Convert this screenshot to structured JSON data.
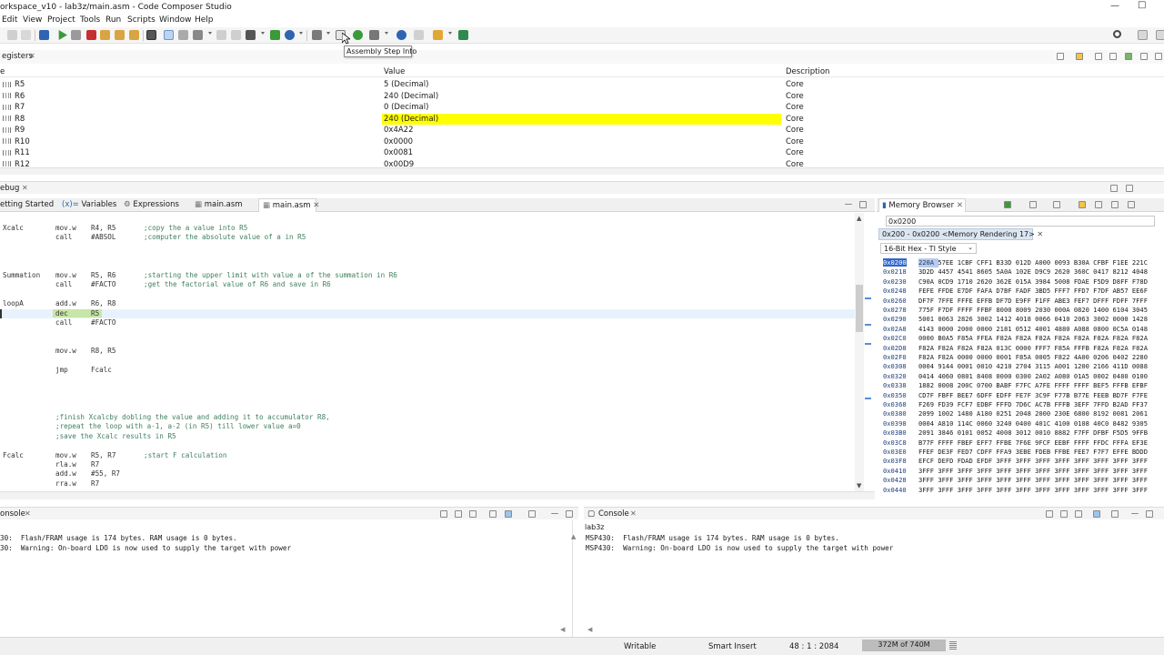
{
  "window": {
    "title": "orkspace_v10 - lab3z/main.asm - Code Composer Studio"
  },
  "menu": [
    "Edit",
    "View",
    "Project",
    "Tools",
    "Run",
    "Scripts",
    "Window",
    "Help"
  ],
  "tooltip": "Assembly Step Into",
  "registers": {
    "tab": "egisters",
    "headers": {
      "name": "e",
      "value": "Value",
      "description": "Description"
    },
    "rows": [
      {
        "name": "R5",
        "value": "5 (Decimal)",
        "description": "Core"
      },
      {
        "name": "R6",
        "value": "240 (Decimal)",
        "description": "Core"
      },
      {
        "name": "R7",
        "value": "0 (Decimal)",
        "description": "Core"
      },
      {
        "name": "R8",
        "value": "240 (Decimal)",
        "description": "Core",
        "changed": true
      },
      {
        "name": "R9",
        "value": "0x4A22",
        "description": "Core"
      },
      {
        "name": "R10",
        "value": "0x0000",
        "description": "Core"
      },
      {
        "name": "R11",
        "value": "0x0081",
        "description": "Core"
      },
      {
        "name": "R12",
        "value": "0x00D9",
        "description": "Core"
      }
    ]
  },
  "debug": {
    "tab": "ebug"
  },
  "editor": {
    "tabs": [
      "etting Started",
      "Variables",
      "Expressions",
      "main.asm",
      "main.asm"
    ],
    "lines": [
      {
        "label": "Xcalc",
        "ins": "mov.w",
        "opd": "R4, R5",
        "cmt": ";copy the a value into R5"
      },
      {
        "label": "",
        "ins": "call",
        "opd": "#ABSOL",
        "cmt": ";computer the absolute value of a in R5"
      },
      {
        "label": "",
        "ins": "",
        "opd": "",
        "cmt": ""
      },
      {
        "label": "",
        "ins": "",
        "opd": "",
        "cmt": ""
      },
      {
        "label": "",
        "ins": "",
        "opd": "",
        "cmt": ""
      },
      {
        "label": "Summation",
        "ins": "mov.w",
        "opd": "R5, R6",
        "cmt": ";starting the upper limit with value a of the summation in R6"
      },
      {
        "label": "",
        "ins": "call",
        "opd": "#FACTO",
        "cmt": ";get the factorial value of R6 and save in R6"
      },
      {
        "label": "",
        "ins": "",
        "opd": "",
        "cmt": ""
      },
      {
        "label": "loopA",
        "ins": "add.w",
        "opd": "R6, R8",
        "cmt": ""
      },
      {
        "label": "",
        "ins": "dec",
        "opd": "R5",
        "cmt": "",
        "current": true
      },
      {
        "label": "",
        "ins": "call",
        "opd": "#FACTO",
        "cmt": ""
      },
      {
        "label": "",
        "ins": "",
        "opd": "",
        "cmt": ""
      },
      {
        "label": "",
        "ins": "",
        "opd": "",
        "cmt": ""
      },
      {
        "label": "",
        "ins": "mov.w",
        "opd": "R8, R5",
        "cmt": ""
      },
      {
        "label": "",
        "ins": "",
        "opd": "",
        "cmt": ""
      },
      {
        "label": "",
        "ins": "jmp",
        "opd": "Fcalc",
        "cmt": ""
      },
      {
        "label": "",
        "ins": "",
        "opd": "",
        "cmt": ""
      },
      {
        "label": "",
        "ins": "",
        "opd": "",
        "cmt": ""
      },
      {
        "label": "",
        "ins": "",
        "opd": "",
        "cmt": ""
      },
      {
        "label": "",
        "ins": "",
        "opd": "",
        "cmt": ""
      },
      {
        "label": "",
        "ins": "",
        "opd": "",
        "cmt": "",
        "cmtline": ";finish Xcalcby dobling the value and adding it to accumulator R8,"
      },
      {
        "label": "",
        "ins": "",
        "opd": "",
        "cmt": "",
        "cmtline": ";repeat the loop with a-1, a-2 (in R5) till lower value a=0"
      },
      {
        "label": "",
        "ins": "",
        "opd": "",
        "cmt": "",
        "cmtline": ";save the Xcalc results in R5"
      },
      {
        "label": "",
        "ins": "",
        "opd": "",
        "cmt": ""
      },
      {
        "label": "Fcalc",
        "ins": "mov.w",
        "opd": "R5, R7",
        "cmt": ";start F calculation"
      },
      {
        "label": "",
        "ins": "rla.w",
        "opd": "R7",
        "cmt": ""
      },
      {
        "label": "",
        "ins": "add.w",
        "opd": "#55, R7",
        "cmt": ""
      },
      {
        "label": "",
        "ins": "rra.w",
        "opd": "R7",
        "cmt": ""
      }
    ]
  },
  "memory": {
    "tab": "Memory Browser",
    "address_input": "0x0200",
    "rendering_tab": "0x200 - 0x0200 <Memory Rendering 17>",
    "style": "16-Bit Hex - TI Style",
    "rows": [
      {
        "addr": "0x0200",
        "words": "220A 57EE 1CBF CFF1 B33D 012D A000 0093 B30A CFBF F1EE 221C"
      },
      {
        "addr": "0x0218",
        "words": "3D2D 4457 4541 8605 5A0A 102E D9C9 2620 360C 0417 8212 4048"
      },
      {
        "addr": "0x0230",
        "words": "C90A 0CD9 1710 2620 362E 015A 3984 5008 FDAE F5D9 D8FF F78D"
      },
      {
        "addr": "0x0248",
        "words": "FEFE FFDE E7DF FAFA D7BF FADF 3BD5 FFF7 FFD7 F7DF AB57 EE6F"
      },
      {
        "addr": "0x0260",
        "words": "DF7F 7FFE FFFE EFFB DF7D E9FF F1FF ABE3 FEF7 DFFF FDFF 7FFF"
      },
      {
        "addr": "0x0278",
        "words": "775F F7DF FFFF FFBF 8000 8009 2030 000A 0820 1400 6104 3045"
      },
      {
        "addr": "0x0290",
        "words": "5001 0063 2826 3002 1412 4018 0066 0410 2063 3002 0000 1428"
      },
      {
        "addr": "0x02A8",
        "words": "4143 0000 2000 0000 2181 0512 4001 4880 A088 0800 0C5A 0148"
      },
      {
        "addr": "0x02C0",
        "words": "0000 B0A5 F85A FFEA F82A F82A F82A F82A F82A F82A F82A F82A"
      },
      {
        "addr": "0x02D8",
        "words": "F82A F82A F82A F82A 013C 0000 FFF7 F85A FFFB F82A F82A F82A"
      },
      {
        "addr": "0x02F0",
        "words": "F82A F82A 0000 0000 0001 F85A 0005 F822 4A00 0206 0402 2280"
      },
      {
        "addr": "0x0308",
        "words": "0004 9144 0001 0010 4210 2704 3115 A001 1200 2166 411D 0088"
      },
      {
        "addr": "0x0320",
        "words": "0414 4060 0801 8408 0000 0300 2A02 A080 01A5 0002 0480 0100"
      },
      {
        "addr": "0x0338",
        "words": "1882 0008 200C 0700 BABF F7FC A7FE FFFF FFFF BEF5 FFFB EFBF"
      },
      {
        "addr": "0x0350",
        "words": "CD7F FBFF BEE7 6DFF EDFF FE7F 3C9F F77B B77E FEEB BD7F F7FE"
      },
      {
        "addr": "0x0368",
        "words": "F269 FD39 FCF7 EDBF FFFD 7D6C AC7B FFFB 3EFF 7FFD B2AD FF37"
      },
      {
        "addr": "0x0380",
        "words": "2099 1002 1480 A180 0251 2048 2000 230E 6800 8192 0081 2061"
      },
      {
        "addr": "0x0398",
        "words": "0004 A810 114C 0060 3240 0400 401C 4100 0108 40C0 8482 9305"
      },
      {
        "addr": "0x03B0",
        "words": "2091 3846 0101 0052 4008 3012 0010 8882 F7FF DFBF F5D5 9FFB"
      },
      {
        "addr": "0x03C8",
        "words": "B77F FFFF FBEF EFF7 FFBE 7F6E 9FCF EEBF FFFF FFDC FFFA EF3E"
      },
      {
        "addr": "0x03E0",
        "words": "FFEF DE3F FED7 CDFF FFA9 3EBE FDEB FFBE FEE7 F7F7 EFFE BDDD"
      },
      {
        "addr": "0x03F8",
        "words": "EFCF DEFD FDAD EFDF 3FFF 3FFF 3FFF 3FFF 3FFF 3FFF 3FFF 3FFF"
      },
      {
        "addr": "0x0410",
        "words": "3FFF 3FFF 3FFF 3FFF 3FFF 3FFF 3FFF 3FFF 3FFF 3FFF 3FFF 3FFF"
      },
      {
        "addr": "0x0428",
        "words": "3FFF 3FFF 3FFF 3FFF 3FFF 3FFF 3FFF 3FFF 3FFF 3FFF 3FFF 3FFF"
      },
      {
        "addr": "0x0440",
        "words": "3FFF 3FFF 3FFF 3FFF 3FFF 3FFF 3FFF 3FFF 3FFF 3FFF 3FFF 3FFF"
      }
    ]
  },
  "console_left": {
    "tab": "onsole",
    "lines": [
      "30:  Flash/FRAM usage is 174 bytes. RAM usage is 0 bytes.",
      "30:  Warning: On-board LDO is now used to supply the target with power"
    ]
  },
  "console_right": {
    "tab": "Console",
    "project": "lab3z",
    "lines": [
      "MSP430:  Flash/FRAM usage is 174 bytes. RAM usage is 0 bytes.",
      "MSP430:  Warning: On-board LDO is now used to supply the target with power"
    ]
  },
  "status": {
    "writable": "Writable",
    "insert_mode": "Smart Insert",
    "position": "48 : 1 : 2084",
    "heap": "372M of 740M"
  }
}
